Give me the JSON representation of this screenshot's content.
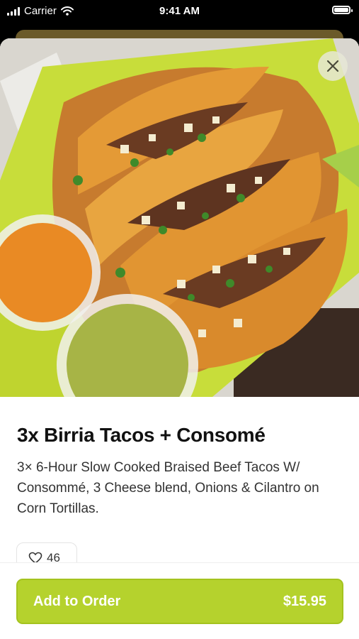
{
  "status_bar": {
    "carrier": "Carrier",
    "time": "9:41 AM"
  },
  "item": {
    "title": "3x Birria Tacos + Consomé",
    "description": "3× 6-Hour Slow Cooked Braised Beef Tacos W/ Consommé, 3 Cheese blend, Onions & Cilantro on Corn Tortillas.",
    "likes": "46"
  },
  "footer": {
    "add_label": "Add to Order",
    "price": "$15.95"
  },
  "colors": {
    "accent": "#b5d22d"
  },
  "icons": {
    "close": "close-icon",
    "like": "heart-icon"
  }
}
